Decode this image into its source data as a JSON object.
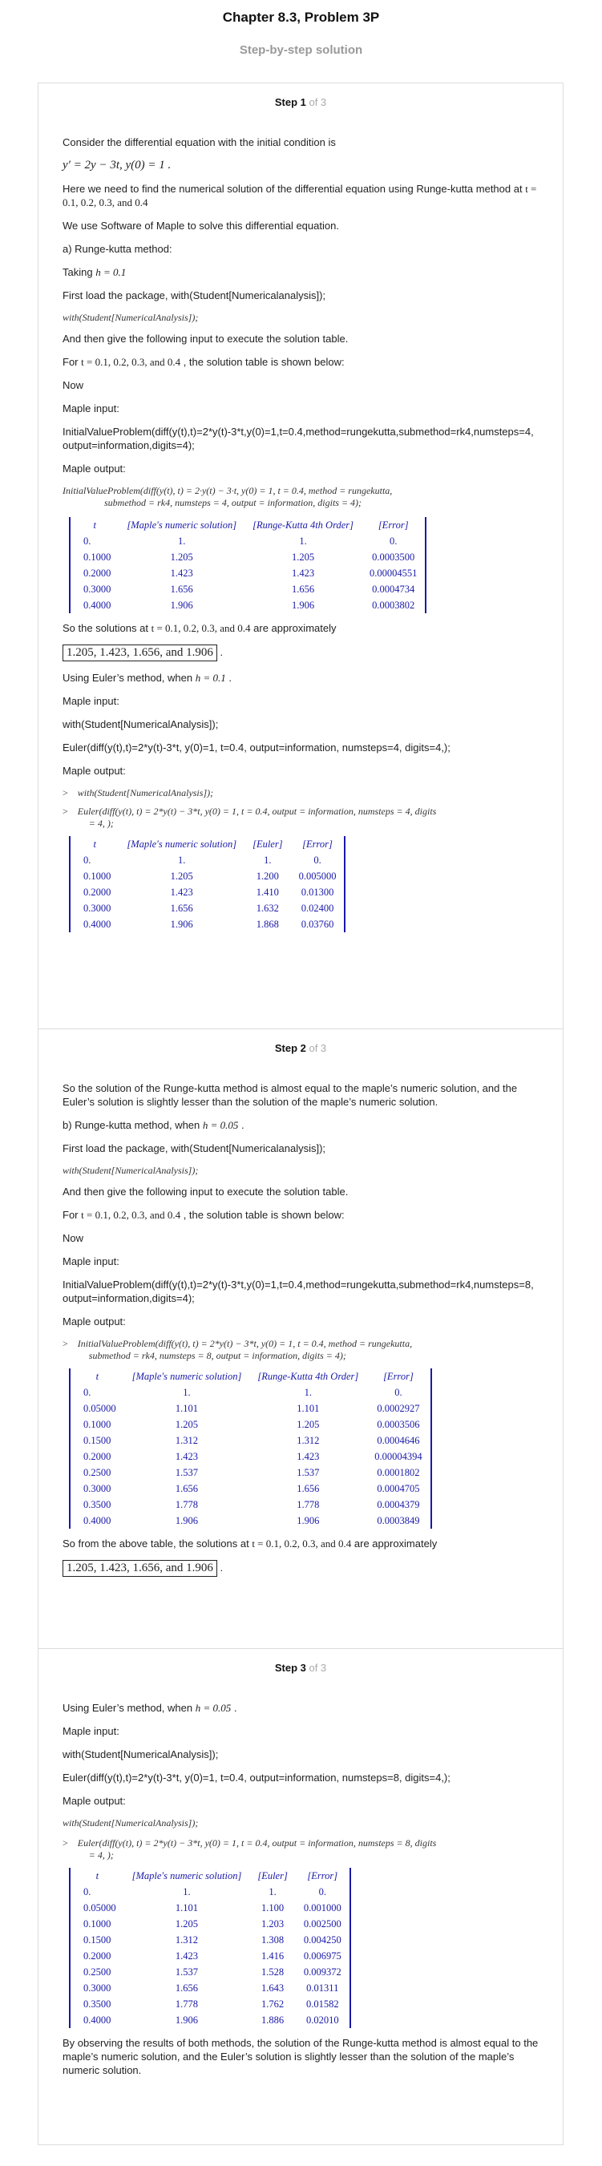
{
  "header": {
    "title": "Chapter 8.3, Problem 3P",
    "subtitle": "Step-by-step solution"
  },
  "step1": {
    "label": "Step 1",
    "of": " of 3",
    "p1": "Consider the differential equation with the initial condition is",
    "eq": "y′ = 2y − 3t,  y(0) = 1 .",
    "p2a": "Here we need to find the numerical solution of the differential equation using Runge-kutta method at ",
    "p2m": "t = 0.1, 0.2, 0.3,  and  0.4",
    "p3": "We use Software of Maple to solve this differential equation.",
    "p4": "a) Runge-kutta method:",
    "p5a": "Taking ",
    "p5m": "h = 0.1",
    "p6": "First load the package, with(Student[Numericalanalysis]);",
    "p7": "with(Student[NumericalAnalysis]);",
    "p8": "And then give the following input to execute the solution table.",
    "p9a": "For ",
    "p9m": "t = 0.1, 0.2, 0.3,  and  0.4",
    "p9b": " , the solution table is shown below:",
    "p10": "Now",
    "p11": "Maple input:",
    "p12": "InitialValueProblem(diff(y(t),t)=2*y(t)-3*t,y(0)=1,t=0.4,method=rungekutta,submethod=rk4,numsteps=4,output=information,digits=4);",
    "p13": "Maple output:",
    "cmd1": "InitialValueProblem(diff(y(t), t) = 2·y(t) − 3·t, y(0) = 1, t = 0.4, method = rungekutta,",
    "cmd2": "submethod = rk4, numsteps = 4, output = information, digits = 4);",
    "table1": {
      "headers": [
        "t",
        "[Maple's numeric solution]",
        "[Runge-Kutta 4th Order]",
        "[Error]"
      ],
      "rows": [
        [
          "0.",
          "1.",
          "1.",
          "0."
        ],
        [
          "0.1000",
          "1.205",
          "1.205",
          "0.0003500"
        ],
        [
          "0.2000",
          "1.423",
          "1.423",
          "0.00004551"
        ],
        [
          "0.3000",
          "1.656",
          "1.656",
          "0.0004734"
        ],
        [
          "0.4000",
          "1.906",
          "1.906",
          "0.0003802"
        ]
      ]
    },
    "p14a": "So the solutions at ",
    "p14m": "t = 0.1, 0.2, 0.3,  and  0.4",
    "p14b": " are approximately",
    "boxed1": "1.205, 1.423, 1.656,  and  1.906",
    "p15a": "Using Euler’s method, when ",
    "p15m": "h = 0.1",
    "p16": "Maple input:",
    "p17": "with(Student[NumericalAnalysis]);",
    "p18": "Euler(diff(y(t),t)=2*y(t)-3*t, y(0)=1, t=0.4, output=information, numsteps=4, digits=4,);",
    "p19": "Maple output:",
    "pr1": "with(Student[NumericalAnalysis]);",
    "pr2a": "Euler(diff(y(t), t) = 2*y(t) − 3*t, y(0) = 1, t = 0.4, output = information, numsteps = 4, digits",
    "pr2b": "= 4, );",
    "table2": {
      "headers": [
        "t",
        "[Maple's numeric solution]",
        "[Euler]",
        "[Error]"
      ],
      "rows": [
        [
          "0.",
          "1.",
          "1.",
          "0."
        ],
        [
          "0.1000",
          "1.205",
          "1.200",
          "0.005000"
        ],
        [
          "0.2000",
          "1.423",
          "1.410",
          "0.01300"
        ],
        [
          "0.3000",
          "1.656",
          "1.632",
          "0.02400"
        ],
        [
          "0.4000",
          "1.906",
          "1.868",
          "0.03760"
        ]
      ]
    }
  },
  "step2": {
    "label": "Step 2",
    "of": " of 3",
    "p1": "So the solution of the Runge-kutta method is almost equal to the maple’s numeric solution, and the Euler’s solution is slightly lesser than the solution of the maple’s numeric solution.",
    "p2a": "b) Runge-kutta method, when ",
    "p2m": "h = 0.05",
    "p3": "First load the package, with(Student[Numericalanalysis]);",
    "p4": "with(Student[NumericalAnalysis]);",
    "p5": "And then give the following input to execute the solution table.",
    "p6a": "For ",
    "p6m": "t = 0.1, 0.2, 0.3,  and  0.4",
    "p6b": " , the solution table is shown below:",
    "p7": "Now",
    "p8": "Maple input:",
    "p9": "InitialValueProblem(diff(y(t),t)=2*y(t)-3*t,y(0)=1,t=0.4,method=rungekutta,submethod=rk4,numsteps=8,output=information,digits=4);",
    "p10": "Maple output:",
    "pr1a": "InitialValueProblem(diff(y(t), t) = 2*y(t) − 3*t, y(0) = 1, t = 0.4, method = rungekutta,",
    "pr1b": "submethod = rk4, numsteps = 8, output = information, digits = 4);",
    "table3": {
      "headers": [
        "t",
        "[Maple's numeric solution]",
        "[Runge-Kutta 4th Order]",
        "[Error]"
      ],
      "rows": [
        [
          "0.",
          "1.",
          "1.",
          "0."
        ],
        [
          "0.05000",
          "1.101",
          "1.101",
          "0.0002927"
        ],
        [
          "0.1000",
          "1.205",
          "1.205",
          "0.0003506"
        ],
        [
          "0.1500",
          "1.312",
          "1.312",
          "0.0004646"
        ],
        [
          "0.2000",
          "1.423",
          "1.423",
          "0.00004394"
        ],
        [
          "0.2500",
          "1.537",
          "1.537",
          "0.0001802"
        ],
        [
          "0.3000",
          "1.656",
          "1.656",
          "0.0004705"
        ],
        [
          "0.3500",
          "1.778",
          "1.778",
          "0.0004379"
        ],
        [
          "0.4000",
          "1.906",
          "1.906",
          "0.0003849"
        ]
      ]
    },
    "p11a": "So from the above table, the solutions at ",
    "p11m": "t = 0.1, 0.2, 0.3,  and  0.4",
    "p11b": " are approximately",
    "boxed2": "1.205, 1.423, 1.656,  and  1.906"
  },
  "step3": {
    "label": "Step 3",
    "of": " of 3",
    "p1a": "Using Euler’s method, when ",
    "p1m": "h = 0.05",
    "p2": "Maple input:",
    "p3": "with(Student[NumericalAnalysis]);",
    "p4": "Euler(diff(y(t),t)=2*y(t)-3*t, y(0)=1, t=0.4, output=information, numsteps=8, digits=4,);",
    "p5": "Maple output:",
    "c1": "with(Student[NumericalAnalysis]);",
    "pr1a": "Euler(diff(y(t), t) = 2*y(t) − 3*t, y(0) = 1, t = 0.4, output = information, numsteps = 8, digits",
    "pr1b": "= 4, );",
    "table4": {
      "headers": [
        "t",
        "[Maple's numeric solution]",
        "[Euler]",
        "[Error]"
      ],
      "rows": [
        [
          "0.",
          "1.",
          "1.",
          "0."
        ],
        [
          "0.05000",
          "1.101",
          "1.100",
          "0.001000"
        ],
        [
          "0.1000",
          "1.205",
          "1.203",
          "0.002500"
        ],
        [
          "0.1500",
          "1.312",
          "1.308",
          "0.004250"
        ],
        [
          "0.2000",
          "1.423",
          "1.416",
          "0.006975"
        ],
        [
          "0.2500",
          "1.537",
          "1.528",
          "0.009372"
        ],
        [
          "0.3000",
          "1.656",
          "1.643",
          "0.01311"
        ],
        [
          "0.3500",
          "1.778",
          "1.762",
          "0.01582"
        ],
        [
          "0.4000",
          "1.906",
          "1.886",
          "0.02010"
        ]
      ]
    },
    "p6": "By observing the results of both methods, the solution of the Runge-kutta method is almost equal to the maple’s numeric solution, and the Euler’s solution is slightly lesser than the solution of the maple’s numeric solution."
  }
}
